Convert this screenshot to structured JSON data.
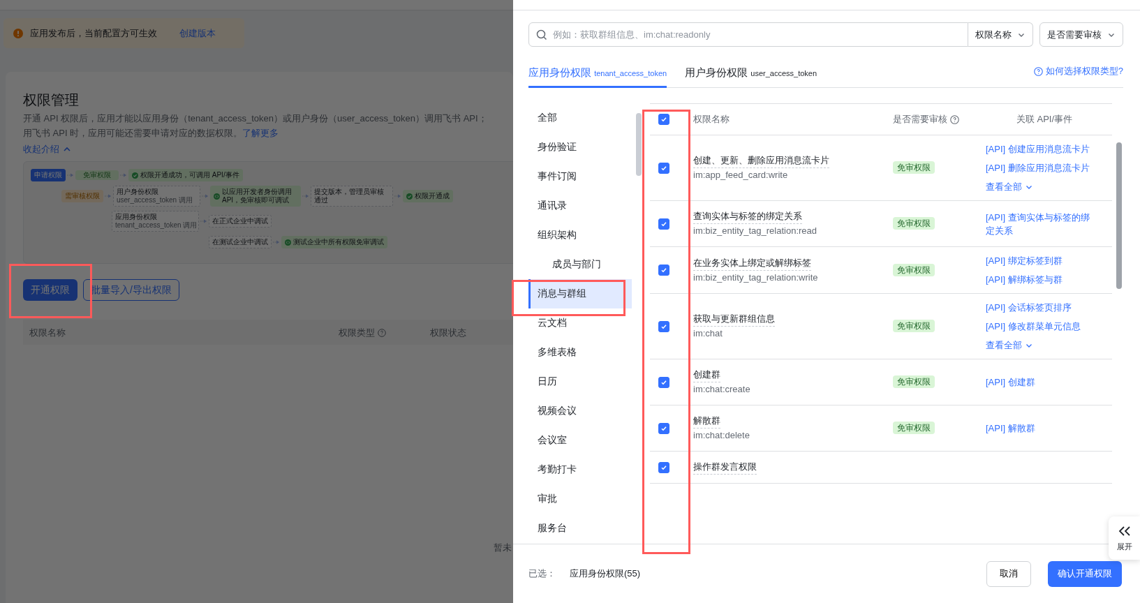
{
  "notice": {
    "text": "应用发布后，当前配置方可生效",
    "link": "创建版本"
  },
  "section": {
    "title": "权限管理",
    "description_lines": [
      "开通 API 权限后，应用才能以应用身份（tenant_access_token）或用户身份（user_access_token）调用飞书 API；",
      "用飞书 API 时，应用可能还需要申请对应的数据权限。"
    ],
    "learn_more": "了解更多",
    "collapse": "收起介绍"
  },
  "flow": {
    "nodes": [
      {
        "kind": "start",
        "text": "申请权限"
      },
      {
        "kind": "free",
        "text": "免审权限"
      },
      {
        "kind": "success",
        "text": "权限开通成功，可调用 API/事件"
      },
      {
        "kind": "review",
        "text": "需审核权限"
      },
      {
        "kind": "step",
        "text": "用户身份权限",
        "sub": "user_access_token 调用"
      },
      {
        "kind": "debug",
        "text": "以应用开发者身份调用 API，免审核即可调试"
      },
      {
        "kind": "step",
        "text": "提交版本，管理员审核通过"
      },
      {
        "kind": "success",
        "text": "权限开通成"
      },
      {
        "kind": "step",
        "text": "应用身份权限",
        "sub": "tenant_access_token 调用"
      },
      {
        "kind": "step",
        "text": "在正式企业中调试"
      },
      {
        "kind": "step",
        "text": "在测试企业中调试"
      },
      {
        "kind": "debug",
        "text": "测试企业中所有权限免审调试"
      }
    ]
  },
  "buttons": {
    "primary": "开通权限",
    "secondary": "批量导入/导出权限"
  },
  "table": {
    "columns": [
      {
        "label": "权限名称",
        "help": false
      },
      {
        "label": "权限类型",
        "help": true
      },
      {
        "label": "权限状态",
        "help": false
      }
    ],
    "empty_text": "暂未"
  },
  "drawer": {
    "search": {
      "placeholder": "例如：获取群组信息、im:chat:readonly",
      "scope": "权限名称"
    },
    "review_filter": "是否需要审核",
    "tabs": [
      {
        "label": "应用身份权限",
        "token": "tenant_access_token",
        "selected": true
      },
      {
        "label": "用户身份权限",
        "token": "user_access_token",
        "selected": false
      }
    ],
    "help_link": "如何选择权限类型?",
    "categories": [
      {
        "label": "全部",
        "selected": false
      },
      {
        "label": "身份验证",
        "selected": false
      },
      {
        "label": "事件订阅",
        "selected": false
      },
      {
        "label": "通讯录",
        "selected": false
      },
      {
        "label": "组织架构",
        "selected": false,
        "children": [
          {
            "label": "成员与部门",
            "selected": false
          }
        ]
      },
      {
        "label": "消息与群组",
        "selected": true
      },
      {
        "label": "云文档",
        "selected": false
      },
      {
        "label": "多维表格",
        "selected": false
      },
      {
        "label": "日历",
        "selected": false
      },
      {
        "label": "视频会议",
        "selected": false
      },
      {
        "label": "会议室",
        "selected": false
      },
      {
        "label": "考勤打卡",
        "selected": false
      },
      {
        "label": "审批",
        "selected": false
      },
      {
        "label": "服务台",
        "selected": false
      }
    ],
    "columns": [
      {
        "label": "权限名称",
        "help": false
      },
      {
        "label": "是否需要审核",
        "help": true
      },
      {
        "label": "关联 API/事件",
        "help": false
      }
    ],
    "select_all": true,
    "rows": [
      {
        "checked": true,
        "name": "创建、更新、删除应用消息流卡片",
        "scope": "im:app_feed_card:write",
        "review": "免审权限",
        "apis": [
          "[API] 创建应用消息流卡片",
          "[API] 删除应用消息流卡片"
        ],
        "more": "查看全部"
      },
      {
        "checked": true,
        "name": "查询实体与标签的绑定关系",
        "scope": "im:biz_entity_tag_relation:read",
        "review": "免审权限",
        "apis": [
          "[API] 查询实体与标签的绑定关系"
        ]
      },
      {
        "checked": true,
        "name": "在业务实体上绑定或解绑标签",
        "scope": "im:biz_entity_tag_relation:write",
        "review": "免审权限",
        "apis": [
          "[API] 绑定标签到群",
          "[API] 解绑标签与群"
        ]
      },
      {
        "checked": true,
        "name": "获取与更新群组信息",
        "scope": "im:chat",
        "review": "免审权限",
        "apis": [
          "[API] 会话标签页排序",
          "[API] 修改群菜单元信息"
        ],
        "more": "查看全部"
      },
      {
        "checked": true,
        "name": "创建群",
        "scope": "im:chat:create",
        "review": "免审权限",
        "apis": [
          "[API] 创建群"
        ]
      },
      {
        "checked": true,
        "name": "解散群",
        "scope": "im:chat:delete",
        "review": "免审权限",
        "apis": [
          "[API] 解散群"
        ]
      },
      {
        "checked": true,
        "name": "操作群发言权限"
      }
    ],
    "footer": {
      "selected_label": "已选：",
      "selected_value": "应用身份权限(55)",
      "cancel": "取消",
      "confirm": "确认开通权限"
    },
    "expand": "展开"
  }
}
